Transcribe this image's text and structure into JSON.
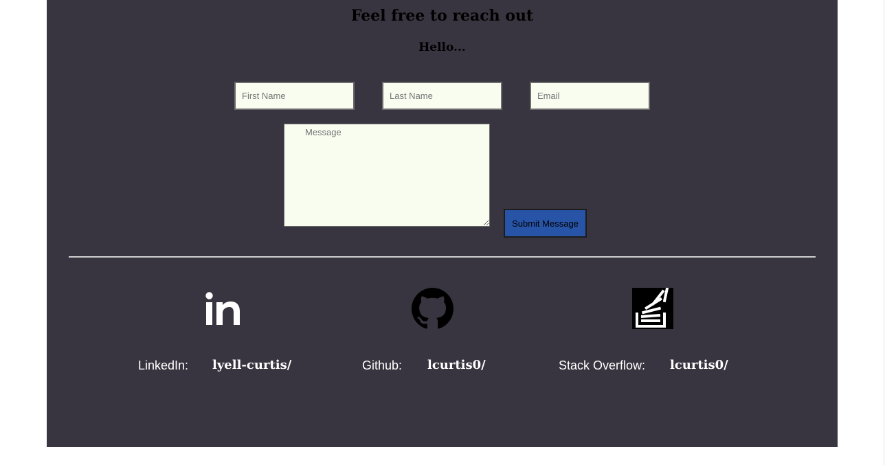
{
  "contact": {
    "title": "Feel free to reach out",
    "subtitle": "Hello...",
    "first_name_placeholder": "First Name",
    "last_name_placeholder": "Last Name",
    "email_placeholder": "Email",
    "message_placeholder": "Message",
    "submit_label": "Submit Message"
  },
  "social": {
    "linkedin": {
      "label": "LinkedIn:",
      "handle": "lyell-curtis/",
      "icon": "linkedin-icon"
    },
    "github": {
      "label": "Github:",
      "handle": "lcurtis0/",
      "icon": "github-icon"
    },
    "stackoverflow": {
      "label": "Stack Overflow:",
      "handle": "lcurtis0/",
      "icon": "stackoverflow-icon"
    }
  },
  "colors": {
    "panel_background": "#393540",
    "field_background": "#f9fdf0",
    "submit_background": "#2854a8",
    "divider": "#cfcfcf",
    "text_light": "#ffffff"
  }
}
